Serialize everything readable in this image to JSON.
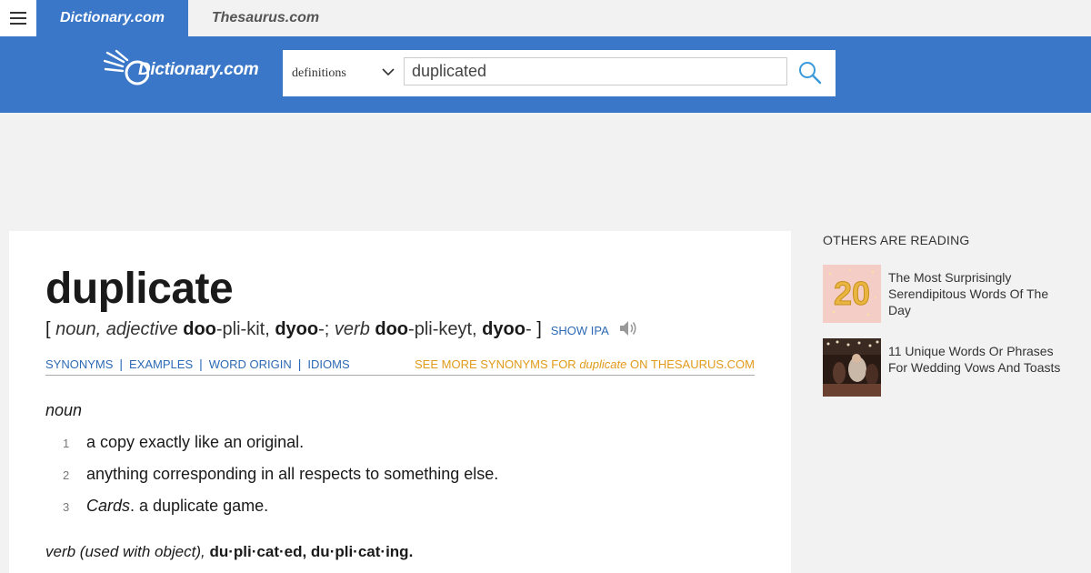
{
  "topbar": {
    "tabs": [
      "Dictionary.com",
      "Thesaurus.com"
    ]
  },
  "header": {
    "logo_text": "Dictionary.com",
    "search": {
      "select_value": "definitions",
      "input_value": "duplicated"
    }
  },
  "entry": {
    "headword": "duplicate",
    "pronunciation": {
      "open_bracket": "[",
      "noun_label": "noun, adjective",
      "p1_bold": "doo",
      "p1_rest": "-pli-kit,",
      "p2_bold": "dyoo",
      "p2_rest": "-;",
      "verb_label": "verb",
      "p3_bold": "doo",
      "p3_rest": "-pli-keyt,",
      "p4_bold": "dyoo",
      "p4_rest": "-",
      "close_bracket": "]",
      "show_ipa": "SHOW IPA"
    },
    "nav_links": [
      "SYNONYMS",
      "EXAMPLES",
      "WORD ORIGIN",
      "IDIOMS"
    ],
    "see_more": {
      "prefix": "SEE MORE SYNONYMS FOR",
      "word": "duplicate",
      "suffix": "ON THESAURUS.COM"
    },
    "noun_section": {
      "pos": "noun",
      "definitions": [
        {
          "num": "1",
          "label": "",
          "text": "a copy exactly like an original."
        },
        {
          "num": "2",
          "label": "",
          "text": "anything corresponding in all respects to something else."
        },
        {
          "num": "3",
          "label": "Cards",
          "text": ". a duplicate game."
        }
      ]
    },
    "verb_line": {
      "pos": "verb (used with object),",
      "forms": "du·pli·cat·ed, du·pli·cat·ing."
    }
  },
  "rail": {
    "title": "OTHERS ARE READING",
    "items": [
      {
        "title": "The Most Surprisingly Serendipitous Words Of The Day",
        "thumb_text": "20"
      },
      {
        "title": "11 Unique Words Or Phrases For Wedding Vows And Toasts",
        "thumb_text": ""
      }
    ]
  },
  "colors": {
    "brand_blue": "#3a77c8",
    "link_blue": "#2d6ab5",
    "thesaurus_orange": "#e09b1a"
  }
}
